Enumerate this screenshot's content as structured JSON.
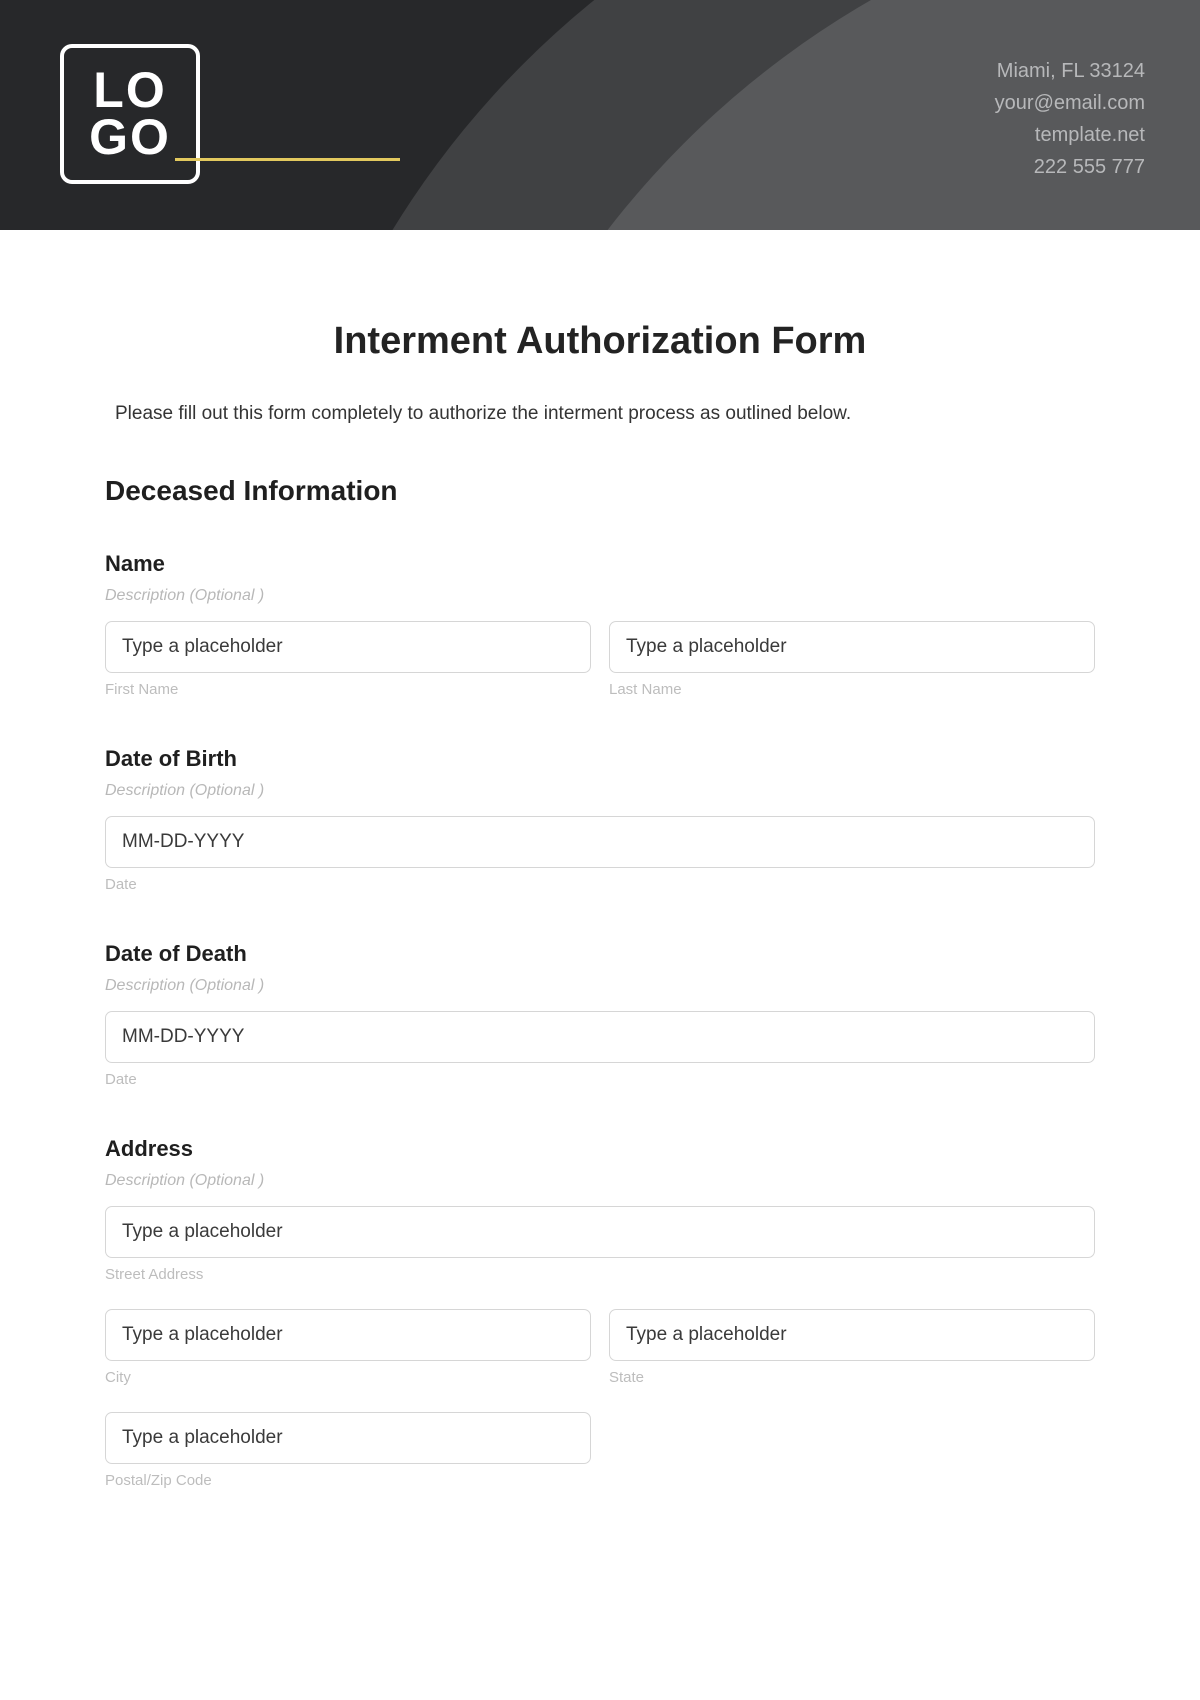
{
  "header": {
    "logo_line1": "LO",
    "logo_line2": "GO",
    "contact": {
      "address": "Miami, FL 33124",
      "email": "your@email.com",
      "website": "template.net",
      "phone": "222 555 777"
    }
  },
  "form": {
    "title": "Interment Authorization Form",
    "intro": "Please fill out this form completely to authorize the interment process as outlined below.",
    "section_heading": "Deceased Information",
    "name": {
      "label": "Name",
      "description": "Description (Optional )",
      "first_placeholder": "Type a placeholder",
      "first_sub": "First Name",
      "last_placeholder": "Type a placeholder",
      "last_sub": "Last Name"
    },
    "dob": {
      "label": "Date of Birth",
      "description": "Description (Optional )",
      "placeholder": "MM-DD-YYYY",
      "sub": "Date"
    },
    "dod": {
      "label": "Date of Death",
      "description": "Description (Optional )",
      "placeholder": "MM-DD-YYYY",
      "sub": "Date"
    },
    "address": {
      "label": "Address",
      "description": "Description (Optional )",
      "street_placeholder": "Type a placeholder",
      "street_sub": "Street Address",
      "city_placeholder": "Type a placeholder",
      "city_sub": "City",
      "state_placeholder": "Type a placeholder",
      "state_sub": "State",
      "zip_placeholder": "Type a placeholder",
      "zip_sub": "Postal/Zip Code"
    }
  }
}
